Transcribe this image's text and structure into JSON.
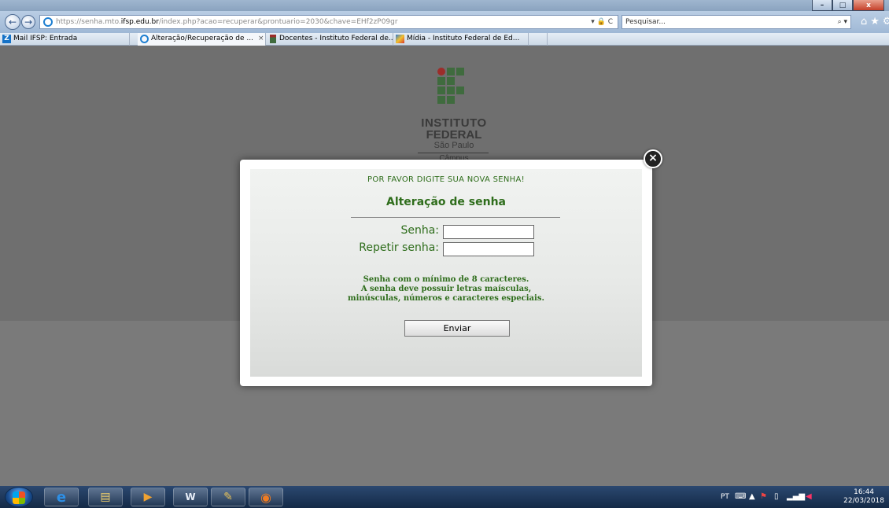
{
  "window": {
    "title": "",
    "controls": {
      "minimize": "–",
      "maximize": "□",
      "close": "x"
    }
  },
  "addressbar": {
    "url_prefix": "https://senha.mto.",
    "url_domain": "ifsp.edu.br",
    "url_path": "/index.php?acao=recuperar&prontuario=2030&chave=EHf2zP09gr",
    "url_controls": "▾ 🔒 C",
    "search_placeholder": "Pesquisar...",
    "search_icon": "⌕ ▾",
    "right_icons": "⌂★⚙"
  },
  "tabs": [
    {
      "label": "Mail IFSP: Entrada",
      "icon": "mail-icon"
    },
    {
      "label": "Alteração/Recuperação de ...",
      "icon": "ie-icon",
      "active": true,
      "close": "×"
    },
    {
      "label": "Docentes - Instituto Federal de...",
      "icon": "ifsp-icon"
    },
    {
      "label": "Mídia - Instituto Federal de Ed...",
      "icon": "media-icon"
    }
  ],
  "logo": {
    "line1": "INSTITUTO",
    "line2": "FEDERAL",
    "line3": "São Paulo",
    "line4": "Câmpus"
  },
  "modal": {
    "close_label": "×",
    "message": "POR FAVOR DIGITE SUA NOVA SENHA!",
    "title": "Alteração de senha",
    "password_label": "Senha:",
    "repeat_label": "Repetir senha:",
    "rule1": "Senha com o mínimo de 8 caracteres.",
    "rule2": "A senha deve possuir letras maísculas,",
    "rule3": "minúsculas, números e caracteres especiais.",
    "submit_label": "Enviar"
  },
  "taskbar": {
    "apps": [
      {
        "name": "ie",
        "glyph": "e"
      },
      {
        "name": "explorer",
        "glyph": "▤"
      },
      {
        "name": "media-player",
        "glyph": "▶"
      },
      {
        "name": "word",
        "glyph": "W"
      },
      {
        "name": "paint",
        "glyph": "✎"
      },
      {
        "name": "firefox",
        "glyph": "◉"
      }
    ],
    "language": "PT",
    "time": "16:44",
    "date": "22/03/2018"
  }
}
